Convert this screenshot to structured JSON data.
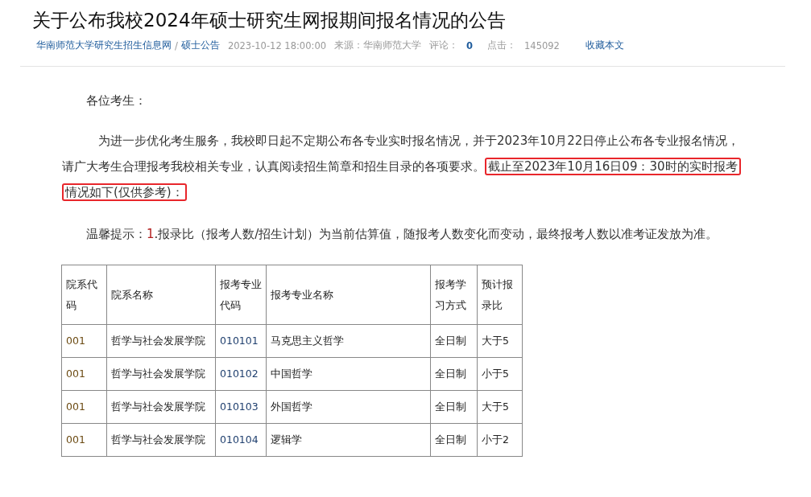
{
  "article": {
    "title": "关于公布我校2024年硕士研究生网报期间报名情况的公告",
    "breadcrumb": [
      {
        "label": "华南师范大学研究生招生信息网"
      },
      {
        "label": "硕士公告"
      }
    ],
    "breadcrumb_separator": "/",
    "date": "2023-10-12 18:00:00",
    "source_label": "来源：",
    "source": "华南师范大学",
    "comments_label": "评论：",
    "comments": "0",
    "clicks_label": "点击：",
    "clicks": "145092",
    "favorite_link": "收藏本文"
  },
  "body": {
    "greeting": "各位考生：",
    "paragraph": [
      {
        "text": "为进一步优化考生服务，我校即日起不定期公布各专业实时报名情况，并于2023年10月22日停止公布各专业报名情况，请广大考生合理报考我校相关专业，认真阅读招生简章和招生目录的各项要求。",
        "highlighted": false
      },
      {
        "text": "截止至2023年10月16日09：30时的实时报考情况如下(仅供参考)：",
        "highlighted": true
      }
    ],
    "tip_label": "温馨提示：",
    "tip_number": "1",
    "tip_text": ".报录比（报考人数/招生计划）为当前估算值，随报考人数变化而变动，最终报考人数以准考证发放为准。"
  },
  "table": {
    "columns": [
      "院系代码",
      "院系名称",
      "报考专业代码",
      "报考专业名称",
      "报考学习方式",
      "预计报录比"
    ],
    "rows": [
      [
        "001",
        "哲学与社会发展学院",
        "010101",
        "马克思主义哲学",
        "全日制",
        "大于5"
      ],
      [
        "001",
        "哲学与社会发展学院",
        "010102",
        "中国哲学",
        "全日制",
        "小于5"
      ],
      [
        "001",
        "哲学与社会发展学院",
        "010103",
        "外国哲学",
        "全日制",
        "大于5"
      ],
      [
        "001",
        "哲学与社会发展学院",
        "010104",
        "逻辑学",
        "全日制",
        "小于2"
      ]
    ]
  }
}
